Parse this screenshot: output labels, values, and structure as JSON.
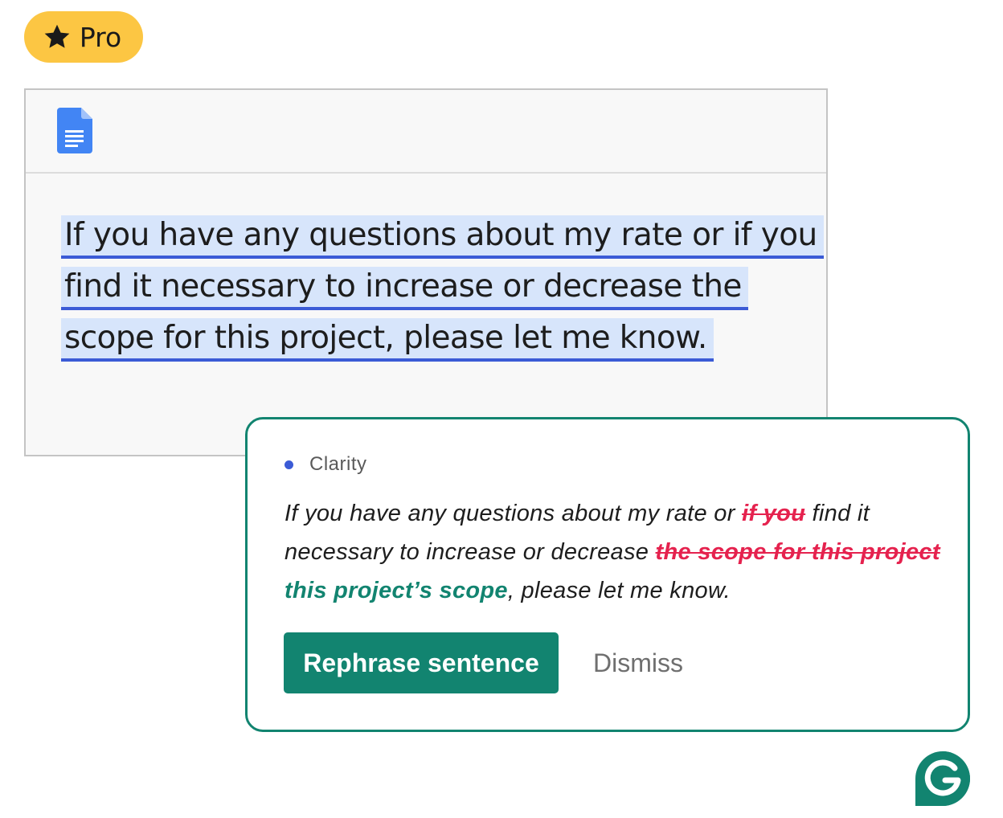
{
  "badge": {
    "label": "Pro",
    "icon": "star-icon"
  },
  "document": {
    "icon": "google-docs-icon",
    "lines": [
      "If you have any questions about my rate or if you",
      "find it necessary to increase or decrease the",
      "scope for this project, please let me know."
    ]
  },
  "suggestion": {
    "category": "Clarity",
    "segments": {
      "s1": "If you have any questions about my rate or ",
      "del1": "if you",
      "s2": " find it necessary to increase or decrease ",
      "del2": "the scope for this project",
      "ins1": "this project’s scope",
      "s3": ", please let me know."
    },
    "primary_button": "Rephrase sentence",
    "secondary_button": "Dismiss"
  },
  "brand": {
    "logo": "grammarly-logo-icon"
  },
  "colors": {
    "badge": "#fcc643",
    "accent": "#128470",
    "highlight": "#d7e5fb",
    "underline": "#3b5bd6",
    "deletion": "#e5224e"
  }
}
